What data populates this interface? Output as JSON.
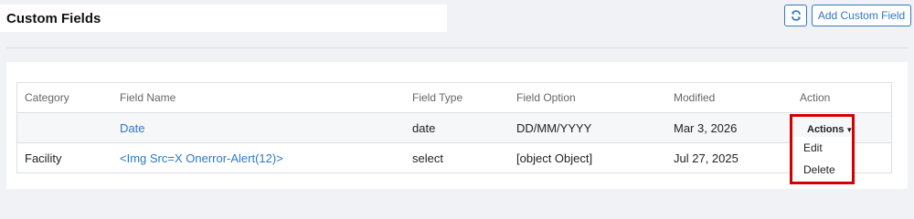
{
  "header": {
    "title": "Custom Fields",
    "refresh_icon": "refresh-icon",
    "add_label": "Add Custom Field"
  },
  "table": {
    "columns": [
      "Category",
      "Field Name",
      "Field Type",
      "Field Option",
      "Modified",
      "Action"
    ],
    "rows": [
      {
        "category": "",
        "field_name": "Date",
        "field_type": "date",
        "field_option": "DD/MM/YYYY",
        "modified": "Mar 3, 2026",
        "action": "Actions"
      },
      {
        "category": "Facility",
        "field_name": "<Img Src=X Onerror-Alert(12)>",
        "field_type": "select",
        "field_option": "[object Object]",
        "modified": "Jul 27, 2025",
        "action": ""
      }
    ]
  },
  "actions_menu": {
    "items": [
      "Edit",
      "Delete"
    ]
  },
  "colors": {
    "accent": "#2f78c4",
    "highlight": "#d40000"
  }
}
